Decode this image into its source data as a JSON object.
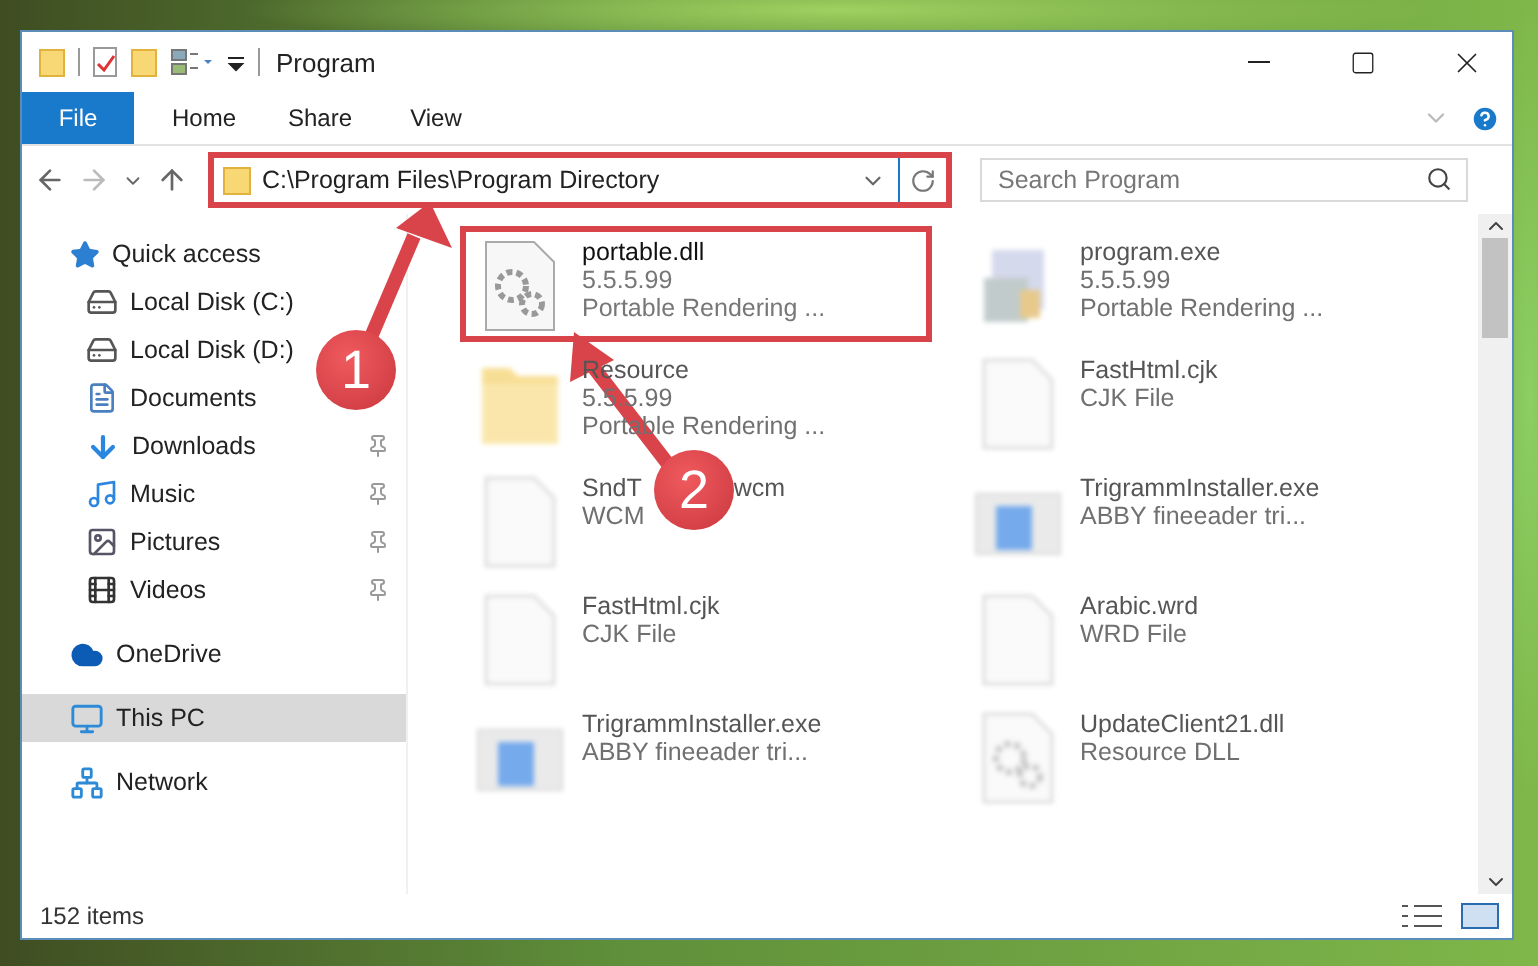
{
  "window": {
    "title": "Program"
  },
  "ribbon": {
    "tabs": [
      {
        "label": "File",
        "selected": true
      },
      {
        "label": "Home",
        "selected": false
      },
      {
        "label": "Share",
        "selected": false
      },
      {
        "label": "View",
        "selected": false
      }
    ]
  },
  "address": {
    "path": "C:\\Program Files\\Program Directory",
    "highlighted": true
  },
  "search": {
    "placeholder": "Search Program"
  },
  "sidebar": {
    "items": [
      {
        "label": "Quick access",
        "selected": false,
        "children": [
          {
            "label": "Local Disk (C:)",
            "pinned": false
          },
          {
            "label": "Local Disk (D:)",
            "pinned": false
          },
          {
            "label": "Documents",
            "pinned": false
          },
          {
            "label": "Downloads",
            "pinned": true
          },
          {
            "label": "Music",
            "pinned": true
          },
          {
            "label": "Pictures",
            "pinned": true
          },
          {
            "label": "Videos",
            "pinned": true
          }
        ]
      },
      {
        "label": "OneDrive",
        "selected": false
      },
      {
        "label": "This PC",
        "selected": true
      },
      {
        "label": "Network",
        "selected": false
      }
    ]
  },
  "files": [
    {
      "name": "portable.dll",
      "details": [
        "5.5.5.99",
        "Portable Rendering ..."
      ],
      "kind": "dll",
      "blurred": false,
      "highlighted": true
    },
    {
      "name": "program.exe",
      "details": [
        "5.5.5.99",
        "Portable Rendering ..."
      ],
      "kind": "exe",
      "blurred": true,
      "highlighted": false
    },
    {
      "name": "Resource",
      "details": [
        "5.5.5.99",
        "Portable Rendering ..."
      ],
      "kind": "folder",
      "blurred": true,
      "highlighted": false
    },
    {
      "name": "FastHtml.cjk",
      "details": [
        "CJK File"
      ],
      "kind": "blank",
      "blurred": true,
      "highlighted": false
    },
    {
      "name": "SndT",
      "name_tail": "wcm",
      "details": [
        "WCM"
      ],
      "kind": "blank",
      "blurred": true,
      "highlighted": false
    },
    {
      "name": "TrigrammInstaller.exe",
      "details": [
        "ABBY fineeader tri..."
      ],
      "kind": "installer",
      "blurred": true,
      "highlighted": false
    },
    {
      "name": "FastHtml.cjk",
      "details": [
        "CJK File"
      ],
      "kind": "blank",
      "blurred": true,
      "highlighted": false
    },
    {
      "name": "Arabic.wrd",
      "details": [
        "WRD File"
      ],
      "kind": "blank",
      "blurred": true,
      "highlighted": false
    },
    {
      "name": "TrigrammInstaller.exe",
      "details": [
        "ABBY fineeader tri..."
      ],
      "kind": "installer",
      "blurred": true,
      "highlighted": false
    },
    {
      "name": "UpdateClient21.dll",
      "details": [
        "Resource DLL"
      ],
      "kind": "dll",
      "blurred": true,
      "highlighted": false
    }
  ],
  "status_bar": {
    "count": "152 items"
  },
  "annotations": [
    {
      "label": "1"
    },
    {
      "label": "2"
    }
  ]
}
